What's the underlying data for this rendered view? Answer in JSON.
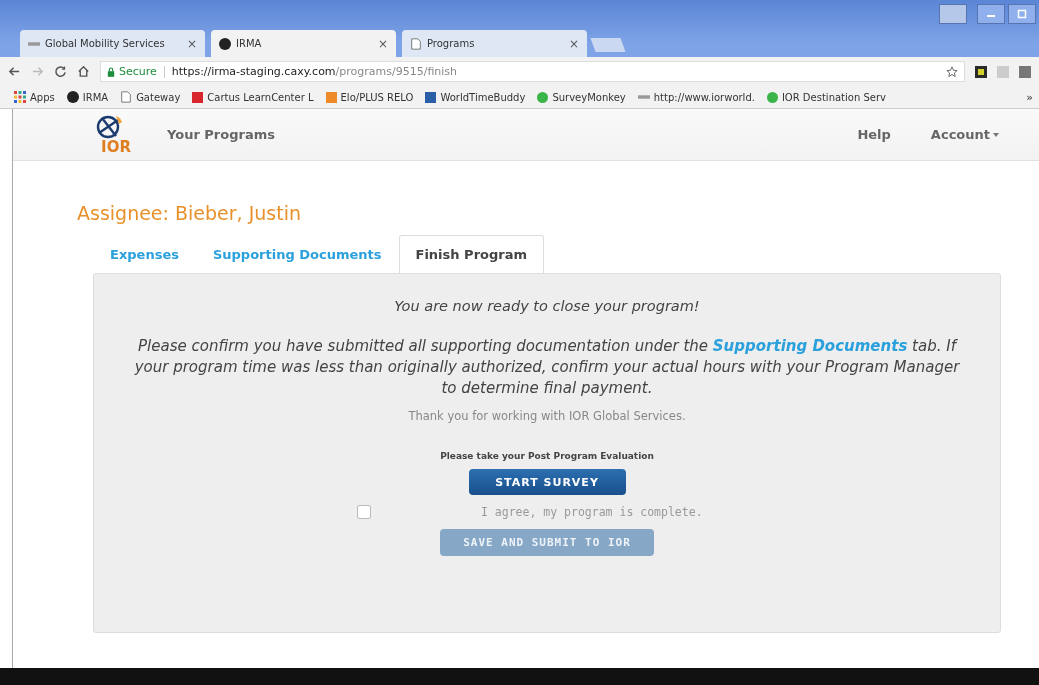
{
  "browser": {
    "tabs": [
      {
        "title": "Global Mobility Services",
        "selected": false
      },
      {
        "title": "IRMA",
        "selected": true
      },
      {
        "title": "Programs",
        "selected": false
      }
    ],
    "close_glyph": "×",
    "address": {
      "secure_label": "Secure",
      "host": "https://irma-staging.caxy.com",
      "path": "/programs/9515/finish"
    },
    "bookmarks": [
      {
        "label": "Apps"
      },
      {
        "label": "IRMA"
      },
      {
        "label": "Gateway"
      },
      {
        "label": "Cartus LearnCenter L"
      },
      {
        "label": "Elo/PLUS RELO"
      },
      {
        "label": "WorldTimeBuddy"
      },
      {
        "label": "SurveyMonkey"
      },
      {
        "label": "http://www.iorworld."
      },
      {
        "label": "IOR Destination Serv"
      }
    ],
    "more_glyph": "»"
  },
  "header": {
    "logo_text": "IOR",
    "nav": [
      "Your Programs"
    ],
    "right_nav": [
      {
        "label": "Help",
        "dropdown": false
      },
      {
        "label": "Account",
        "dropdown": true
      }
    ]
  },
  "assignee_title": "Assignee: Bieber, Justin",
  "tabs": [
    {
      "label": "Expenses",
      "selected": false
    },
    {
      "label": "Supporting Documents",
      "selected": false
    },
    {
      "label": "Finish Program",
      "selected": true
    }
  ],
  "panel": {
    "headline": "You are now ready to close your program!",
    "message": {
      "before": "Please confirm you have submitted all supporting documentation under the",
      "link": "Supporting Documents",
      "after": "tab. If your program time was less than originally authorized, confirm your actual hours with your Program Manager to determine final payment."
    },
    "thanks": "Thank you for working with IOR Global Services.",
    "survey_prompt": "Please take your Post Program Evaluation",
    "survey_button": "START SURVEY",
    "agree": {
      "label": "I agree, my program is complete.",
      "checked": false
    },
    "submit": {
      "label": "SAVE AND SUBMIT TO IOR",
      "disabled": true
    }
  }
}
